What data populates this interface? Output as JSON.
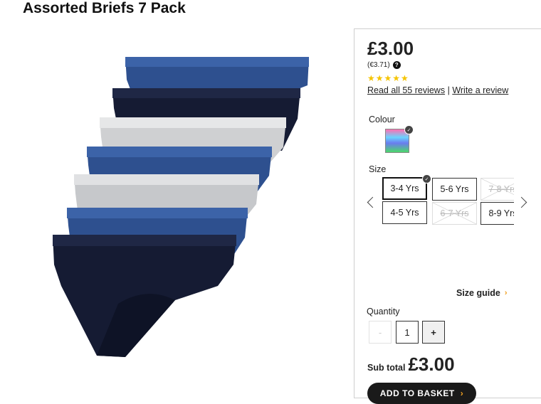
{
  "product": {
    "title": "Assorted Briefs 7 Pack"
  },
  "pricing": {
    "price": "£3.00",
    "alt_price": "(€3.71)",
    "rating": 5,
    "stars": "★★★★★",
    "reviews_link": "Read all 55 reviews",
    "separator": "|",
    "write_review": "Write a review"
  },
  "colour": {
    "label": "Colour",
    "selected_swatch": "multi"
  },
  "size": {
    "label": "Size",
    "options": [
      {
        "label": "3-4 Yrs",
        "state": "selected"
      },
      {
        "label": "5-6 Yrs",
        "state": "available"
      },
      {
        "label": "7-8 Yrs",
        "state": "unavailable"
      },
      {
        "label": "4-5 Yrs",
        "state": "available"
      },
      {
        "label": "6-7 Yrs",
        "state": "unavailable"
      },
      {
        "label": "8-9 Yrs",
        "state": "available"
      }
    ],
    "guide_label": "Size guide"
  },
  "quantity": {
    "label": "Quantity",
    "value": "1",
    "decrement": "-",
    "increment": "+"
  },
  "subtotal": {
    "label": "Sub total",
    "value": "£3.00"
  },
  "basket": {
    "label": "ADD TO BASKET"
  },
  "icons": {
    "help": "question-icon",
    "check": "check-icon",
    "prev": "chevron-left-icon",
    "next": "chevron-right-icon",
    "go": "chevron-right-small-icon"
  },
  "colors": {
    "navy": "#151b33",
    "blue": "#2e508f",
    "grey": "#cfd0d2",
    "star": "#f5c400",
    "accent": "#f0a020"
  }
}
